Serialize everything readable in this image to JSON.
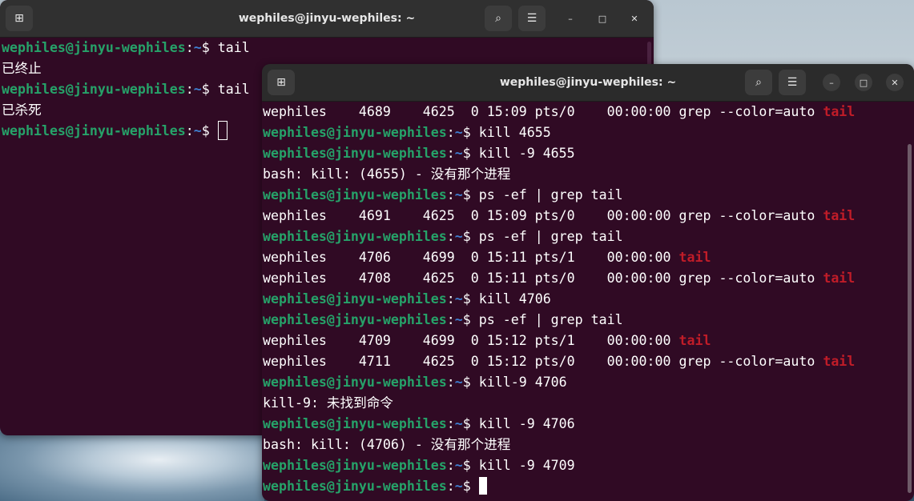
{
  "back_window": {
    "title": "wephiles@jinyu-wephiles: ~",
    "prompt": {
      "user": "wephiles@jinyu-wephiles",
      "colon": ":",
      "path": "~",
      "symbol": "$ "
    },
    "lines": [
      {
        "type": "cmd",
        "cmd": "tail"
      },
      {
        "type": "out",
        "text": "已终止"
      },
      {
        "type": "cmd",
        "cmd": "tail"
      },
      {
        "type": "out",
        "text": "已杀死"
      },
      {
        "type": "prompt_cursor"
      }
    ]
  },
  "front_window": {
    "title": "wephiles@jinyu-wephiles: ~",
    "prompt": {
      "user": "wephiles@jinyu-wephiles",
      "colon": ":",
      "path": "~",
      "symbol": "$ "
    },
    "lines": [
      {
        "type": "ps",
        "text": "wephiles    4689    4625  0 15:09 pts/0    00:00:00 grep --color=auto ",
        "hl": "tail"
      },
      {
        "type": "cmd",
        "cmd": "kill 4655"
      },
      {
        "type": "cmd",
        "cmd": "kill -9 4655"
      },
      {
        "type": "out",
        "text": "bash: kill: (4655) - 没有那个进程"
      },
      {
        "type": "cmd",
        "cmd": "ps -ef | grep tail"
      },
      {
        "type": "ps",
        "text": "wephiles    4691    4625  0 15:09 pts/0    00:00:00 grep --color=auto ",
        "hl": "tail"
      },
      {
        "type": "cmd",
        "cmd": "ps -ef | grep tail"
      },
      {
        "type": "ps",
        "text": "wephiles    4706    4699  0 15:11 pts/1    00:00:00 ",
        "hl": "tail"
      },
      {
        "type": "ps",
        "text": "wephiles    4708    4625  0 15:11 pts/0    00:00:00 grep --color=auto ",
        "hl": "tail"
      },
      {
        "type": "cmd",
        "cmd": "kill 4706"
      },
      {
        "type": "cmd",
        "cmd": "ps -ef | grep tail"
      },
      {
        "type": "ps",
        "text": "wephiles    4709    4699  0 15:12 pts/1    00:00:00 ",
        "hl": "tail"
      },
      {
        "type": "ps",
        "text": "wephiles    4711    4625  0 15:12 pts/0    00:00:00 grep --color=auto ",
        "hl": "tail"
      },
      {
        "type": "cmd",
        "cmd": "kill-9 4706"
      },
      {
        "type": "out",
        "text": "kill-9: 未找到命令"
      },
      {
        "type": "cmd",
        "cmd": "kill -9 4706"
      },
      {
        "type": "out",
        "text": "bash: kill: (4706) - 没有那个进程"
      },
      {
        "type": "cmd",
        "cmd": "kill -9 4709"
      },
      {
        "type": "prompt_cursor"
      }
    ]
  },
  "icons": {
    "new_tab": "⊞",
    "search": "⌕",
    "menu": "☰",
    "minimize": "–",
    "maximize": "□",
    "close": "✕"
  },
  "colors": {
    "terminal_bg": "#300a24",
    "prompt_user": "#26a269",
    "prompt_path": "#3f7fd0",
    "grep_highlight": "#c01c28",
    "titlebar": "#2b2b2b"
  }
}
